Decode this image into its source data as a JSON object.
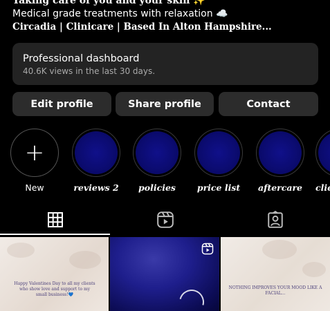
{
  "bio": {
    "line1": "Taking care of you and your skin ✨",
    "line2": "Medical grade treatments with relaxation ☁️",
    "line3": "Circadia | Clinicare | Based In Alton Hampshire..."
  },
  "dashboard": {
    "title": "Professional dashboard",
    "subtitle": "40.6K views in the last 30 days."
  },
  "buttons": {
    "edit": "Edit profile",
    "share": "Share profile",
    "contact": "Contact"
  },
  "highlights": [
    {
      "label": "New",
      "icon": "plus-icon"
    },
    {
      "label": "reviews 2"
    },
    {
      "label": "policies"
    },
    {
      "label": "price list"
    },
    {
      "label": "aftercare"
    },
    {
      "label": "clie"
    }
  ],
  "tabs": [
    {
      "icon": "grid-icon",
      "active": true
    },
    {
      "icon": "reels-icon",
      "active": false
    },
    {
      "icon": "tagged-icon",
      "active": false
    }
  ],
  "posts": [
    {
      "text": "Happy Valentines Day to all my clients who show love and support to my small business!💙"
    },
    {
      "icon": "reel-icon"
    },
    {
      "text": "NOTHING IMPROVES YOUR MOOD LIKE A FACIAL..."
    }
  ],
  "colors": {
    "background": "#000000",
    "button": "#2c2c2c",
    "card": "#232323",
    "highlight_fill": "#0a0a6a",
    "post_bg": "#ede5de"
  }
}
